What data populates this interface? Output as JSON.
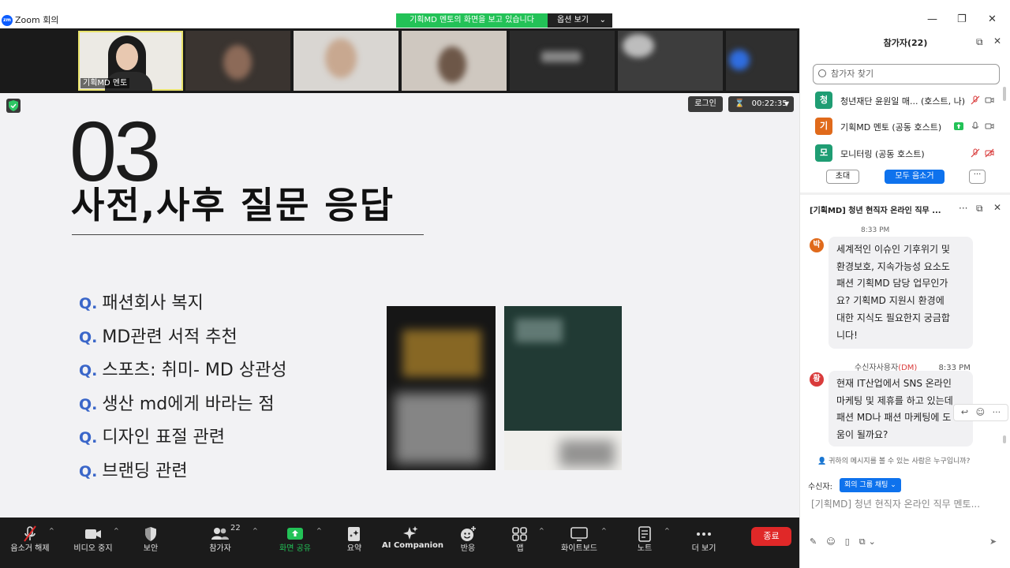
{
  "window": {
    "app_title": "Zoom 회의",
    "logo_text": "zm",
    "share_banner": "기획MD 멘토의 화면을 보고 있습니다",
    "view_options": "옵션 보기"
  },
  "video_strip": {
    "active_speaker": "기획MD 멘토"
  },
  "stage": {
    "login_label": "로그인",
    "timer": "00:22:35",
    "slide": {
      "number": "03",
      "title": "사전,사후 질문 응답",
      "question_marker": "Q.",
      "questions": [
        "패션회사 복지",
        "MD관련 서적 추천",
        "스포츠: 취미- MD 상관성",
        "생산 md에게 바라는 점",
        "디자인 표절 관련",
        "브랜딩 관련"
      ]
    }
  },
  "toolbar": {
    "items": [
      {
        "label": "음소거 해제",
        "icon": "mic-off-icon"
      },
      {
        "label": "비디오 중지",
        "icon": "video-icon"
      },
      {
        "label": "보안",
        "icon": "shield-icon"
      },
      {
        "label": "참가자",
        "icon": "participants-icon",
        "count": "22"
      },
      {
        "label": "화면 공유",
        "icon": "share-screen-icon"
      },
      {
        "label": "요약",
        "icon": "summary-icon"
      },
      {
        "label": "AI Companion",
        "icon": "ai-sparkle-icon"
      },
      {
        "label": "반응",
        "icon": "reaction-icon"
      },
      {
        "label": "앱",
        "icon": "apps-icon"
      },
      {
        "label": "화이트보드",
        "icon": "whiteboard-icon"
      },
      {
        "label": "노트",
        "icon": "notes-icon"
      },
      {
        "label": "더 보기",
        "icon": "more-icon"
      }
    ],
    "end_label": "종료",
    "colors": {
      "share_active": "#23c257",
      "end": "#e02828"
    }
  },
  "participants_panel": {
    "title": "참가자(22)",
    "search_placeholder": "참가자 찾기",
    "participants": [
      {
        "initial": "청",
        "name": "청년재단 윤원일 매...  (호스트, 나)",
        "color": "#1f9d73"
      },
      {
        "initial": "기",
        "name": "기획MD 멘토 (공동 호스트)",
        "color": "#e06a1b"
      },
      {
        "initial": "모",
        "name": "모니터링 (공동 호스트)",
        "color": "#1f9d73"
      }
    ],
    "invite_label": "초대",
    "mute_all_label": "모두 음소거",
    "more_label": "···"
  },
  "chat_panel": {
    "title": "[기획MD] 청년 현직자 온라인 직무 ...",
    "messages": [
      {
        "time": "8:33 PM",
        "initial": "박",
        "color": "#e06a1b",
        "lines": [
          "세계적인 이슈인 기후위기 및",
          "환경보호, 지속가능성 요소도",
          "패션 기획MD 담당 업무인가",
          "요? 기획MD 지원시 환경에",
          "대한 지식도 필요한지 궁금합",
          "니다!"
        ]
      },
      {
        "sender": "수신자사용자",
        "dm_tag": "(DM)",
        "time": "8:33 PM",
        "initial": "황",
        "color": "#d93b3b",
        "lines": [
          "현재 IT산업에서 SNS 온라인",
          "마케팅 및 제휴를 하고 있는데",
          "패션 MD나 패션 마케팅에 도",
          "움이 될까요?"
        ]
      }
    ],
    "visibility_note": "귀하의 메시지를 볼 수 있는 사람은 누구입니까?",
    "to_label": "수신자:",
    "to_value": "회의 그룹 채팅",
    "compose_placeholder": "[기획MD] 청년 현직자 온라인 직무 멘토..."
  }
}
